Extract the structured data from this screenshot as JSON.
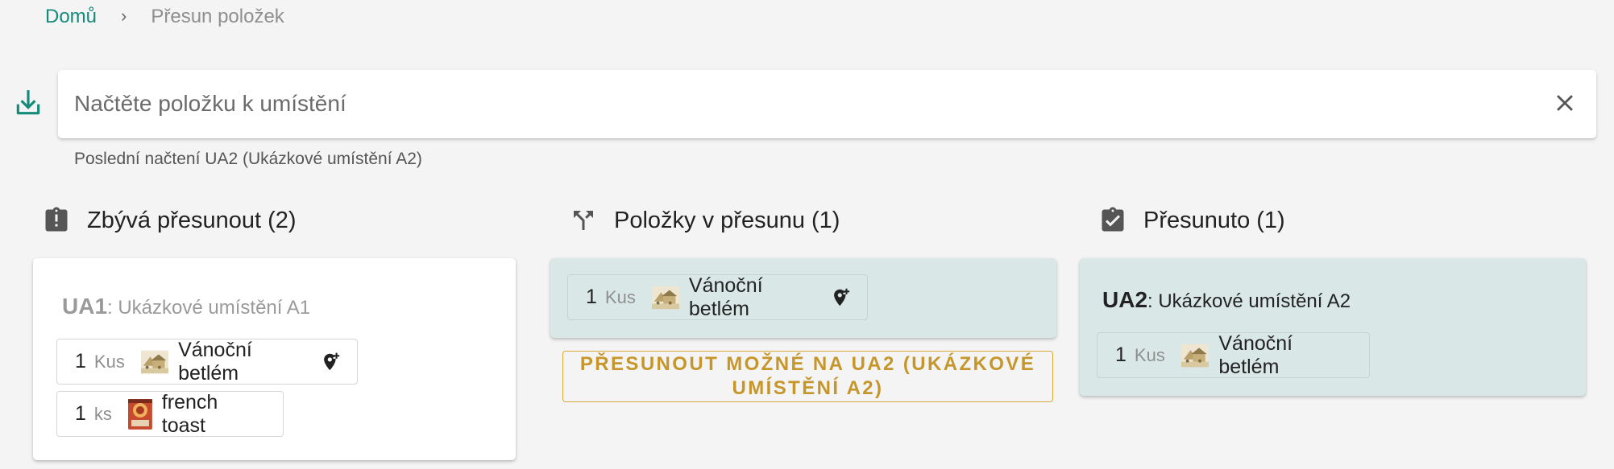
{
  "breadcrumb": {
    "home": "Domů",
    "separator": "›",
    "current": "Přesun položek"
  },
  "scan": {
    "placeholder": "Načtěte položku k umístění",
    "last_loaded": "Poslední načtení UA2 (Ukázkové umístění A2)"
  },
  "icons": {
    "download": "download-icon",
    "clear": "close-icon",
    "remaining": "clipboard-alert-icon",
    "moving": "call-split-icon",
    "moved": "clipboard-check-icon",
    "add_location": "add-location-icon"
  },
  "colors": {
    "accent": "#168a7a",
    "move_button": "#c6962a",
    "teal_card": "#dae7e7"
  },
  "columns": {
    "remaining": {
      "title": "Zbývá přesunout (2)",
      "location_code": "UA1",
      "location_name": ": Ukázkové umístění A1",
      "items": [
        {
          "qty": "1",
          "unit": "Kus",
          "name": "Vánoční betlém"
        },
        {
          "qty": "1",
          "unit": "ks",
          "name": "french toast"
        }
      ]
    },
    "moving": {
      "title": "Položky v přesunu (1)",
      "items": [
        {
          "qty": "1",
          "unit": "Kus",
          "name": "Vánoční betlém"
        }
      ],
      "move_button": "Přesunout možné na UA2 (Ukázkové umístění A2)"
    },
    "moved": {
      "title": "Přesunuto (1)",
      "location_code": "UA2",
      "location_name": ": Ukázkové umístění A2",
      "items": [
        {
          "qty": "1",
          "unit": "Kus",
          "name": "Vánoční betlém"
        }
      ]
    }
  }
}
